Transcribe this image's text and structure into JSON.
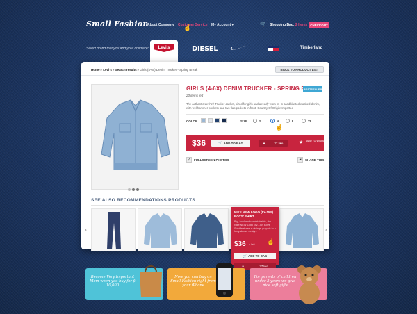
{
  "header": {
    "logo": "Small Fashion",
    "nav": [
      "About Company",
      "Customer Service",
      "My Account"
    ],
    "cart_label": "Shopping Bag:",
    "cart_count": "2 Items",
    "checkout": "CHECKOUT"
  },
  "brands": {
    "prompt": "Select brand that you and your child like:",
    "items": [
      "Levi's",
      "DIESEL",
      "nike",
      "tommy",
      "Timberland"
    ],
    "active": "Levi's"
  },
  "breadcrumb": {
    "home": "Home",
    "brand": "Levi's",
    "results": "Search results",
    "current": "Girls (4-6x) Denim Trucker - Spring Break",
    "back": "BACK TO PRODUCT LIST"
  },
  "product": {
    "title": "GIRLS (4-6X) DENIM TRUCKER - SPRING BREAK",
    "badge": "BESTSELLER",
    "stock": "20 items left",
    "description": "The authentic Levi's® Trucker Jacket, sized for girls and already worn in. In sandblasted washed denim, with wellhammer pockets and two flap pockets in front. Country Of Origin: Imported",
    "color_label": "COLOR",
    "colors": [
      "#9cb8d4",
      "#e1e5ea",
      "#23426e",
      "#162b4d"
    ],
    "size_label": "SIZE",
    "sizes": [
      "S",
      "M",
      "L",
      "XL"
    ],
    "selected_size": "M",
    "price": "$36",
    "add_to_bag": "ADD TO BAG",
    "likes": "37 like",
    "wishlist": "ADD TO WISHLIST",
    "fullscreen": "FULLSCREEN PHOTOS",
    "share": "SHARE THIS"
  },
  "recommendations": {
    "title": "SEE ALSO RECOMMENDATIONS PRODUCTS"
  },
  "popup": {
    "title": "NIKE NEW LOGO (8Y-15Y) BOYS' SHIRT",
    "description": "Big, bold and unmistakable, the Nike NEW Logo (8y-15y) Boys' Shirt features a vintage graphic in a long-sleeve design.",
    "price": "$36",
    "left": "4 left",
    "add_to_bag": "ADD TO BAG",
    "likes": "37 like"
  },
  "promos": [
    {
      "text": "Become Very Important Mom when you buy for $ 10,000",
      "color": "#4fc3d8"
    },
    {
      "text": "Now you can buy on Small Fashion right from your iPhone",
      "color": "#f2a93b"
    },
    {
      "text": "For parents of children under 3 years we give nice soft gifts",
      "color": "#ec7e9b"
    }
  ]
}
